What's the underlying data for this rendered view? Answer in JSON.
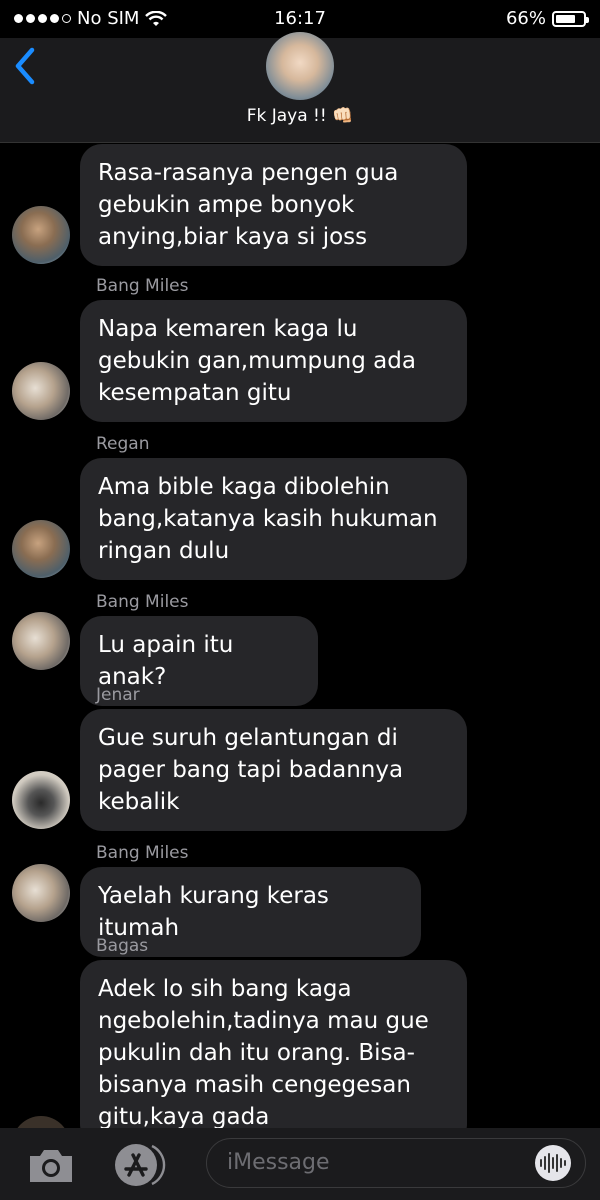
{
  "status_bar": {
    "carrier": "No SIM",
    "time": "16:17",
    "battery": "66%",
    "battery_level": 0.66
  },
  "header": {
    "title": "Fk Jaya !! 👊🏻",
    "back_icon": "chevron-left-icon"
  },
  "messages": [
    {
      "sender": "",
      "text": "Rasa-rasanya pengen gua gebukin ampe bonyok anying,biar kaya si joss",
      "avatar": "regan"
    },
    {
      "sender": "Bang Miles",
      "text": "Napa kemaren kaga lu gebukin gan,mumpung ada kesempatan gitu",
      "avatar": "miles"
    },
    {
      "sender": "Regan",
      "text": "Ama bible kaga dibolehin bang,katanya kasih hukuman ringan dulu",
      "avatar": "regan"
    },
    {
      "sender": "Bang Miles",
      "text": "Lu apain itu anak?",
      "avatar": "miles"
    },
    {
      "sender": "Jenar",
      "text": "Gue suruh gelantungan di pager bang tapi badannya kebalik",
      "avatar": "jenar"
    },
    {
      "sender": "Bang Miles",
      "text": "Yaelah kurang keras itumah",
      "avatar": "miles"
    },
    {
      "sender": "Bagas",
      "text": "Adek lo sih bang kaga ngebolehin,tadinya mau gue pukulin dah itu orang. Bisa-bisanya masih cengegesan gitu,kaya gada",
      "avatar": "bagas"
    }
  ],
  "bottom_bar": {
    "input_placeholder": "iMessage",
    "camera_icon": "camera-icon",
    "appstore_icon": "app-store-icon",
    "audio_icon": "audio-waveform-icon"
  }
}
